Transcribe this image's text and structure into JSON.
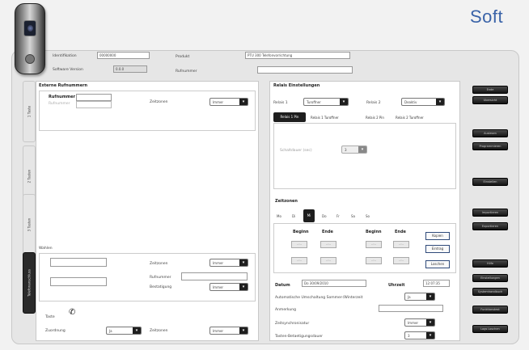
{
  "brand": "Soft",
  "header": {
    "ident_label": "Identifikation",
    "ident_value": "00000000",
    "software_label": "Software Version",
    "software_value": "0.0.0",
    "product_label": "Produkt",
    "product_value": "PTU 300 Telefonvorrichtung",
    "callnum_label": "Rufnummer",
    "callnum_value": ""
  },
  "left_tabs": [
    "1 Taste",
    "2 Tasten",
    "3 Tasten",
    "Telefonanschluss"
  ],
  "left_tabs_active": 3,
  "taste": {
    "title": "Externe Rufnummern",
    "rufnummer_label": "Rufnummer",
    "rufnummer2_label": "Rufnummer",
    "zeitzonen_label": "Zeitzonen",
    "zeitzonen_value": "Immer"
  },
  "waehlen": {
    "title": "Wahlen",
    "zeitzonen_label": "Zeitzonen",
    "zeitzonen_value": "Immer",
    "rufnummer_label": "Rufnummer",
    "bestaetigung_label": "Bestatigung",
    "bestaetigung_value": "Immer"
  },
  "taste_row": {
    "title": "Taste",
    "zuordnung_label": "Zuordnung",
    "zuordnung_value": "Ja",
    "zeitzonen_label": "Zeitzonen",
    "zeitzonen_value": "Immer"
  },
  "relais": {
    "title": "Relais Einstellungen",
    "relais1_label": "Relais 1",
    "relais1_value": "Turoffner",
    "relais2_label": "Relais 2",
    "relais2_value": "Deaktiv",
    "tabs": [
      "Relais 1 Pin",
      "Relais 1 Turoffner",
      "Relais 2 Pin",
      "Relais 2 Turoffner"
    ],
    "schaltdauer_label": "Schaltdauer (sec)",
    "schaltdauer_value": "3"
  },
  "zeitzonen": {
    "title": "Zeitzonen",
    "days": [
      "Mo",
      "Di",
      "Mi",
      "Do",
      "Fr",
      "Sa",
      "So"
    ],
    "active_day": "Mi",
    "beginn_label": "Beginn",
    "ende_label": "Ende",
    "time_placeholder": "--:--",
    "kopien": "Kopien",
    "eintrag": "Eintrag",
    "loeschen": "Loschen",
    "datum_label": "Datum",
    "datum_value": "Do 30/09/2010",
    "uhrzeit_label": "Uhrzeit",
    "uhrzeit_value": "12:07:35",
    "auto_label": "Automatische Umschaltung Sommer-/Winterzeit",
    "auto_value": "Ja",
    "anmerkung_label": "Anmerkung",
    "zeitsynchro_label": "Zeitsynchronisatur",
    "zeitsynchro_value": "Immer",
    "tasten_label": "Tasten-Betaetigungsdauer",
    "tasten_value": "3"
  },
  "side_buttons": [
    "Ende",
    "Ubersicht",
    "Auslesen",
    "Programmieren",
    "Einstellen",
    "Importieren",
    "Exportieren",
    "Hilfe",
    "Einstellungen",
    "Systemhandbuch",
    "Funktionstest",
    "Logs Loschen"
  ]
}
